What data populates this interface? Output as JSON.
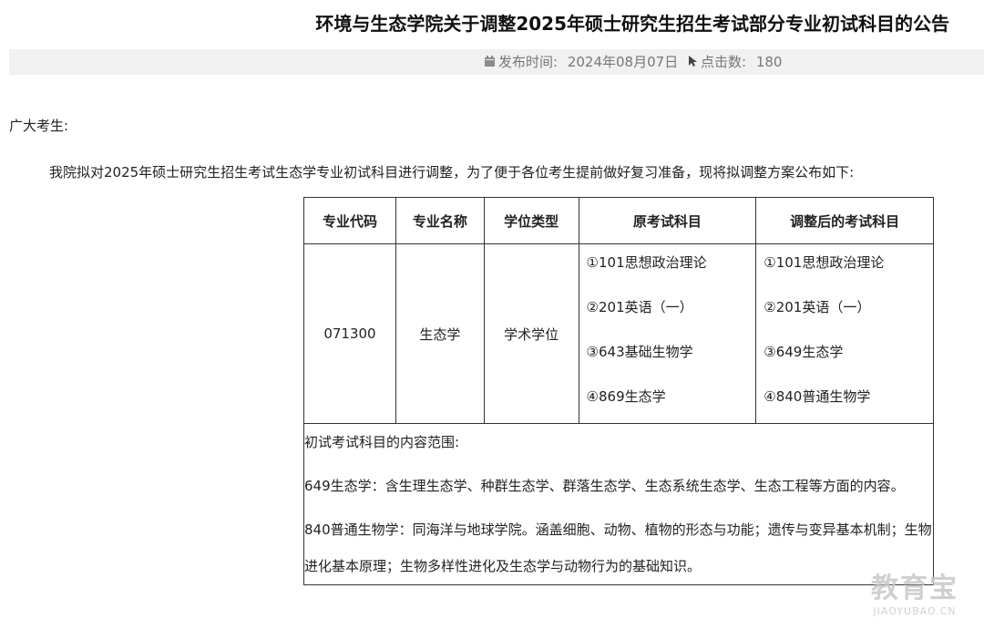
{
  "title": "环境与生态学院关于调整2025年硕士研究生招生考试部分专业初试科目的公告",
  "meta": {
    "publish_label": "发布时间:",
    "publish_date": "2024年08月07日",
    "clicks_label": "点击数:",
    "clicks": "180",
    "icons": [
      "calendar-icon",
      "cursor-icon"
    ]
  },
  "greeting": "广大考生:",
  "intro": "我院拟对2025年硕士研究生招生考试生态学专业初试科目进行调整，为了便于各位考生提前做好复习准备，现将拟调整方案公布如下:",
  "table": {
    "headers": [
      "专业代码",
      "专业名称",
      "学位类型",
      "原考试科目",
      "调整后的考试科目"
    ],
    "row": {
      "code": "071300",
      "name": "生态学",
      "degree": "学术学位",
      "original": [
        "①101思想政治理论",
        "②201英语（一）",
        "③643基础生物学",
        "④869生态学"
      ],
      "adjusted": [
        "①101思想政治理论",
        "②201英语（一）",
        "③649生态学",
        "④840普通生物学"
      ]
    },
    "scope": {
      "heading": "初试考试科目的内容范围:",
      "items": [
        "649生态学：含生理生态学、种群生态学、群落生态学、生态系统生态学、生态工程等方面的内容。",
        "840普通生物学：同海洋与地球学院。涵盖细胞、动物、植物的形态与功能；遗传与变异基本机制；生物进化基本原理；生物多样性进化及生态学与动物行为的基础知识。"
      ]
    }
  },
  "watermark": {
    "cn": "教育宝",
    "en": "JIAOYUBAO.CN"
  }
}
